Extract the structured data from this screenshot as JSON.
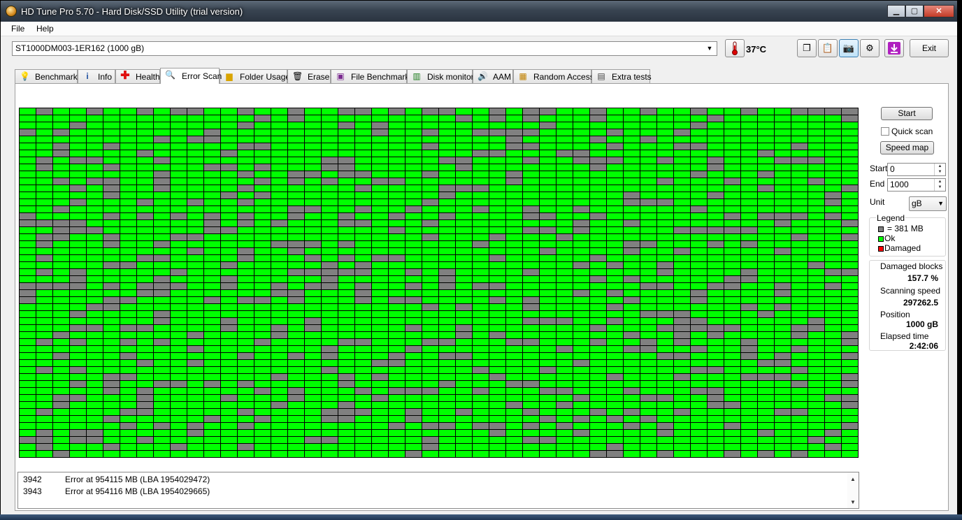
{
  "window": {
    "title": "HD Tune Pro 5.70 - Hard Disk/SSD Utility (trial version)"
  },
  "menu": [
    "File",
    "Help"
  ],
  "toolbar": {
    "drive": "ST1000DM003-1ER162 (1000 gB)",
    "temperature": "37°C",
    "exit_label": "Exit"
  },
  "tabs": [
    {
      "label": "Benchmark",
      "icon": "benchmark-icon"
    },
    {
      "label": "Info",
      "icon": "info-icon"
    },
    {
      "label": "Health",
      "icon": "health-icon"
    },
    {
      "label": "Error Scan",
      "icon": "magnifier-icon",
      "active": true
    },
    {
      "label": "Folder Usage",
      "icon": "folder-icon"
    },
    {
      "label": "Erase",
      "icon": "trash-icon"
    },
    {
      "label": "File Benchmark",
      "icon": "file-benchmark-icon"
    },
    {
      "label": "Disk monitor",
      "icon": "disk-monitor-icon"
    },
    {
      "label": "AAM",
      "icon": "speaker-icon"
    },
    {
      "label": "Random Access",
      "icon": "random-access-icon"
    },
    {
      "label": "Extra tests",
      "icon": "extra-tests-icon"
    }
  ],
  "scan_map": {
    "columns": 50,
    "rows": 50,
    "colors": {
      "ok": "#00ff00",
      "block": "#808080",
      "damaged": "#ff0000"
    }
  },
  "log": [
    {
      "num": "3942",
      "msg": "Error at 954115 MB (LBA 1954029472)"
    },
    {
      "num": "3943",
      "msg": "Error at 954116 MB (LBA 1954029665)"
    }
  ],
  "side": {
    "start_button": "Start",
    "quick_scan": "Quick scan",
    "speed_map_button": "Speed map",
    "start_label": "Start",
    "start_value": "0",
    "end_label": "End",
    "end_value": "1000",
    "unit_label": "Unit",
    "unit_value": "gB",
    "legend": {
      "title": "Legend",
      "block": "= 381 MB",
      "ok": "Ok",
      "damaged": "Damaged"
    },
    "stats": {
      "damaged_blocks_label": "Damaged blocks",
      "damaged_blocks_value": "157.7 %",
      "scanning_speed_label": "Scanning speed",
      "scanning_speed_value": "297262.5",
      "position_label": "Position",
      "position_value": "1000 gB",
      "elapsed_label": "Elapsed time",
      "elapsed_value": "2:42:06"
    }
  }
}
